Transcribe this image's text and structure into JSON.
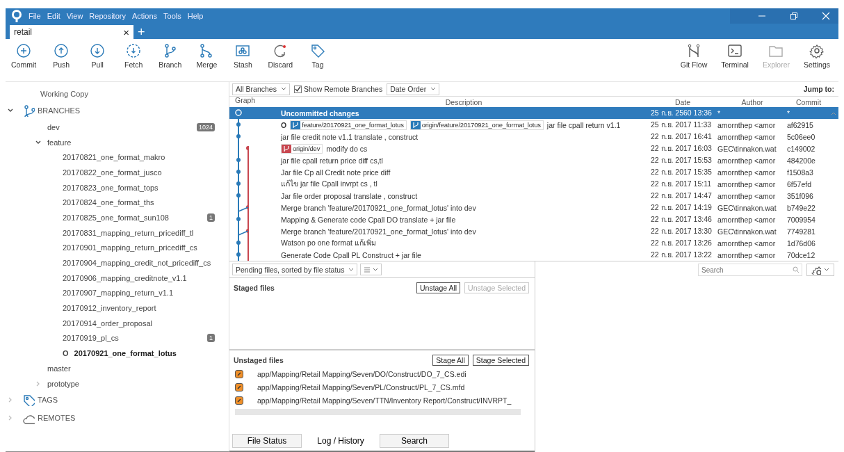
{
  "menu": [
    "File",
    "Edit",
    "View",
    "Repository",
    "Actions",
    "Tools",
    "Help"
  ],
  "tabs": [
    {
      "label": "retail",
      "selected": true,
      "close": "×"
    }
  ],
  "new_tab": "+",
  "toolbar": [
    {
      "label": "Commit"
    },
    {
      "label": "Push"
    },
    {
      "label": "Pull"
    },
    {
      "label": "Fetch"
    },
    {
      "label": "Branch"
    },
    {
      "label": "Merge"
    },
    {
      "label": "Stash"
    },
    {
      "label": "Discard"
    },
    {
      "label": "Tag"
    }
  ],
  "toolbar_right": [
    {
      "label": "Git Flow",
      "disabled": false
    },
    {
      "label": "Terminal",
      "disabled": false
    },
    {
      "label": "Explorer",
      "disabled": true
    },
    {
      "label": "Settings",
      "disabled": false
    }
  ],
  "sidebar": {
    "working_copy": "Working Copy",
    "sections": [
      {
        "label": "BRANCHES",
        "expanded": true,
        "children": [
          {
            "label": "dev",
            "badge": "1024"
          },
          {
            "label": "feature",
            "expanded": true,
            "children": [
              {
                "label": "20170821_one_format_makro"
              },
              {
                "label": "20170822_one_format_jusco"
              },
              {
                "label": "20170823_one_format_tops"
              },
              {
                "label": "20170824_one_format_ths"
              },
              {
                "label": "20170825_one_format_sun108",
                "badge": "1"
              },
              {
                "label": "20170831_mapping_return_pricediff_tl"
              },
              {
                "label": "20170901_mapping_return_pricediff_cs"
              },
              {
                "label": "20170904_mapping_credit_not_pricediff_cs"
              },
              {
                "label": "20170906_mapping_creditnote_v1.1"
              },
              {
                "label": "20170907_mapping_return_v1.1"
              },
              {
                "label": "20170912_inventory_report"
              },
              {
                "label": "20170914_order_proposal"
              },
              {
                "label": "20170919_pl_cs",
                "badge": "1"
              },
              {
                "label": "20170921_one_format_lotus",
                "current": true,
                "marker": "O"
              }
            ]
          },
          {
            "label": "master"
          },
          {
            "label": "prototype",
            "expanded": false
          }
        ]
      },
      {
        "label": "TAGS",
        "expanded": false
      },
      {
        "label": "REMOTES",
        "expanded": false
      }
    ]
  },
  "log": {
    "filters": {
      "branches": "All Branches",
      "show_remote": {
        "label": "Show Remote Branches",
        "checked": true
      },
      "order": "Date Order"
    },
    "jump_to": "Jump to:",
    "columns": [
      "Graph",
      "Description",
      "Date",
      "Author",
      "Commit"
    ],
    "rows": [
      {
        "kind": "working",
        "description": "Uncommitted changes",
        "date": "25 ก.ย. 2560 13:36",
        "author": "*",
        "commit": "*",
        "selected": true
      },
      {
        "kind": "main",
        "marker": "O",
        "refs": [
          {
            "text": "feature/20170921_one_format_lotus",
            "color": "#2a7ab8"
          },
          {
            "text": "origin/feature/20170921_one_format_lotus",
            "color": "#2a7ab8"
          }
        ],
        "description": "jar file cpall return v1.1",
        "date": "25 ก.ย. 2017 11:33",
        "author": "amornthep <amor",
        "commit": "af62915",
        "selected": false
      },
      {
        "kind": "main",
        "description": "jar file credit note v1.1  translate , construct",
        "date": "22 ก.ย. 2017 16:41",
        "author": "amornthep <amor",
        "commit": "5c06ee0",
        "selected": false
      },
      {
        "kind": "dev",
        "refs": [
          {
            "text": "origin/dev",
            "color": "#c8464f"
          }
        ],
        "description": "modify do cs",
        "date": "22 ก.ย. 2017 16:03",
        "author": "GEC\\tinnakon.wat",
        "commit": "c149002",
        "selected": false
      },
      {
        "kind": "main",
        "description": "jar file cpall return price diff  cs,tl",
        "date": "22 ก.ย. 2017 15:53",
        "author": "amornthep <amor",
        "commit": "484200e",
        "selected": false
      },
      {
        "kind": "main",
        "description": "Jar file Cp all Credit note price diff",
        "date": "22 ก.ย. 2017 15:35",
        "author": "amornthep <amor",
        "commit": "f1508a3",
        "selected": false
      },
      {
        "kind": "main",
        "description": "แก้ไข jar file Cpall invrpt cs , tl",
        "date": "22 ก.ย. 2017 15:11",
        "author": "amornthep <amor",
        "commit": "6f57efd",
        "selected": false
      },
      {
        "kind": "main",
        "description": "Jar file order proposal translate , construct",
        "date": "22 ก.ย. 2017 14:47",
        "author": "amornthep <amor",
        "commit": "351f096",
        "selected": false
      },
      {
        "kind": "dev",
        "description": "Merge branch 'feature/20170921_one_format_lotus' into dev",
        "date": "22 ก.ย. 2017 14:19",
        "author": "GEC\\tinnakon.wat",
        "commit": "b749e22",
        "selected": false
      },
      {
        "kind": "main",
        "description": "Mapping & Generate code Cpall DO translate + jar file",
        "date": "22 ก.ย. 2017 13:46",
        "author": "amornthep <amor",
        "commit": "7009954",
        "selected": false
      },
      {
        "kind": "dev",
        "description": "Merge branch 'feature/20170921_one_format_lotus' into dev",
        "date": "22 ก.ย. 2017 13:30",
        "author": "GEC\\tinnakon.wat",
        "commit": "7749281",
        "selected": false
      },
      {
        "kind": "main",
        "description": "Watson po one format แก้เพิ่ม",
        "date": "22 ก.ย. 2017 13:26",
        "author": "amornthep <amor",
        "commit": "1d76d06",
        "selected": false
      },
      {
        "kind": "main",
        "description": "Generate Code Cpall PL Construct + jar file",
        "date": "22 ก.ย. 2017 13:22",
        "author": "amornthep <amor",
        "commit": "70dce12",
        "selected": false
      }
    ]
  },
  "pending": {
    "sort": "Pending files, sorted by file status",
    "staged": {
      "title": "Staged files",
      "buttons": [
        {
          "label": "Unstage All",
          "disabled": false
        },
        {
          "label": "Unstage Selected",
          "disabled": true
        }
      ]
    },
    "unstaged": {
      "title": "Unstaged files",
      "buttons": [
        {
          "label": "Stage All",
          "disabled": false
        },
        {
          "label": "Stage Selected",
          "disabled": false
        }
      ],
      "files": [
        "app/Mapping/Retail Mapping/Seven/DO/Construct/DO_7_CS.edi",
        "app/Mapping/Retail Mapping/Seven/PL/Construct/PL_7_CS.mfd",
        "app/Mapping/Retail Mapping/Seven/TTN/Inventory Report/Construct/INVRPT_"
      ]
    }
  },
  "search": {
    "placeholder": "Search"
  },
  "view_tabs": [
    {
      "label": "File Status",
      "selected": false
    },
    {
      "label": "Log / History",
      "selected": true
    },
    {
      "label": "Search",
      "selected": false
    }
  ]
}
